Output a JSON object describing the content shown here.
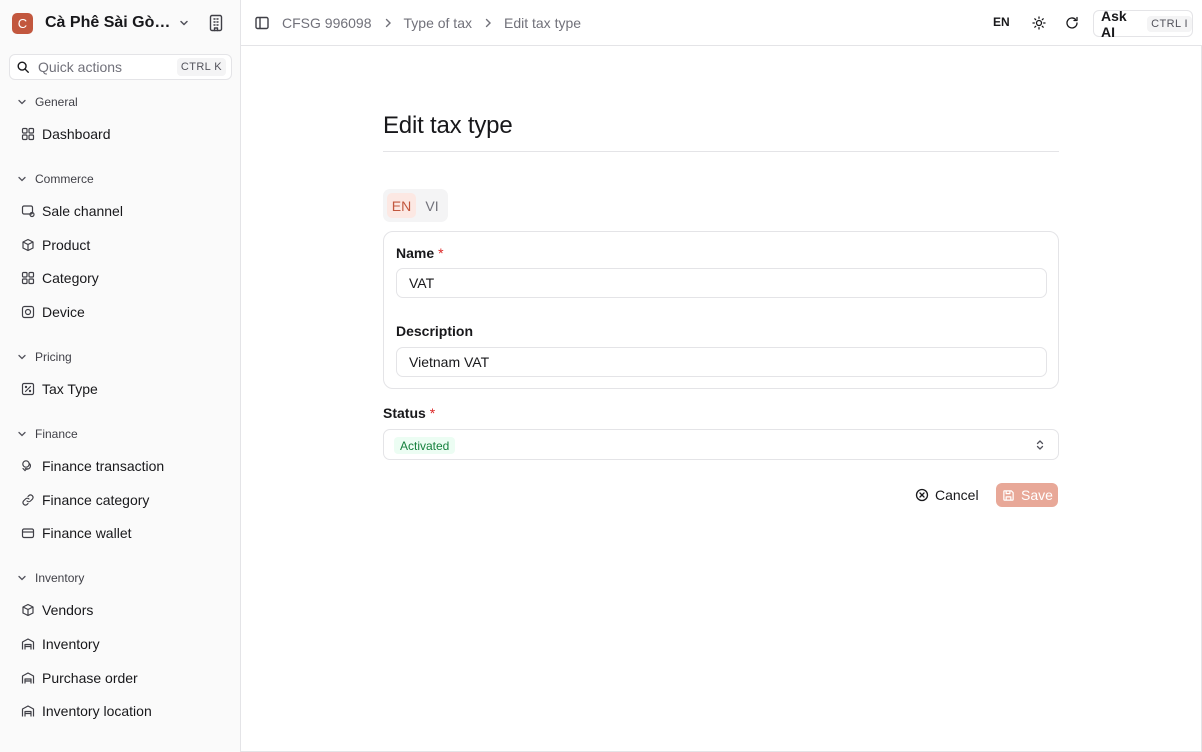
{
  "brand": {
    "logo_letter": "C",
    "name": "Cà Phê Sài Gòn Chợ Lớn"
  },
  "search": {
    "placeholder": "Quick actions",
    "shortcut": "CTRL K"
  },
  "sidebar": {
    "groups": [
      {
        "title": "General",
        "items": [
          {
            "label": "Dashboard",
            "icon": "grid-icon"
          }
        ]
      },
      {
        "title": "Commerce",
        "items": [
          {
            "label": "Sale channel",
            "icon": "channel-icon"
          },
          {
            "label": "Product",
            "icon": "box-icon"
          },
          {
            "label": "Category",
            "icon": "grid-icon"
          },
          {
            "label": "Device",
            "icon": "device-icon"
          }
        ]
      },
      {
        "title": "Pricing",
        "items": [
          {
            "label": "Tax Type",
            "icon": "percent-icon"
          }
        ]
      },
      {
        "title": "Finance",
        "items": [
          {
            "label": "Finance transaction",
            "icon": "coins-icon"
          },
          {
            "label": "Finance category",
            "icon": "link-icon"
          },
          {
            "label": "Finance wallet",
            "icon": "wallet-icon"
          }
        ]
      },
      {
        "title": "Inventory",
        "items": [
          {
            "label": "Vendors",
            "icon": "box-icon"
          },
          {
            "label": "Inventory",
            "icon": "warehouse-icon"
          },
          {
            "label": "Purchase order",
            "icon": "truck-icon"
          },
          {
            "label": "Inventory location",
            "icon": "warehouse-icon"
          }
        ]
      }
    ]
  },
  "topbar": {
    "breadcrumbs": [
      "CFSG 996098",
      "Type of tax",
      "Edit tax type"
    ],
    "language": "EN",
    "ask_ai": {
      "label": "Ask AI",
      "shortcut": "CTRL I"
    }
  },
  "form": {
    "title": "Edit tax type",
    "lang_tabs": [
      "EN",
      "VI"
    ],
    "active_lang": "EN",
    "name": {
      "label": "Name",
      "required": "*",
      "value": "VAT"
    },
    "description": {
      "label": "Description",
      "value": "Vietnam VAT"
    },
    "status": {
      "label": "Status",
      "required": "*",
      "value": "Activated"
    },
    "cancel_label": "Cancel",
    "save_label": "Save"
  },
  "colors": {
    "accent": "#c2573e",
    "accent_light": "#e8a898",
    "status_green": "#15803d",
    "border": "#e4e4e7"
  }
}
